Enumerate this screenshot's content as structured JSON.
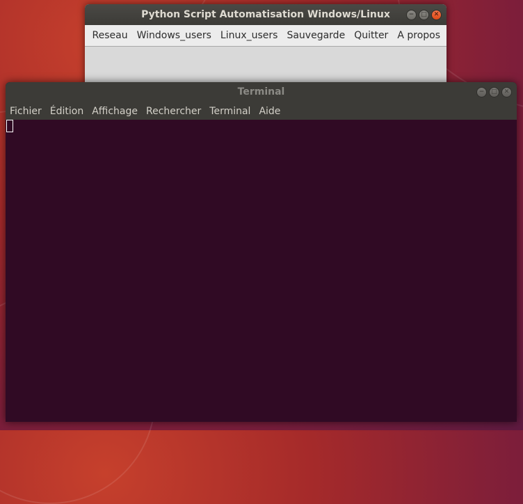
{
  "app_window": {
    "title": "Python Script Automatisation Windows/Linux",
    "menu": [
      "Reseau",
      "Windows_users",
      "Linux_users",
      "Sauvegarde",
      "Quitter",
      "A propos"
    ]
  },
  "terminal_window": {
    "title": "Terminal",
    "menu": [
      "Fichier",
      "Édition",
      "Affichage",
      "Rechercher",
      "Terminal",
      "Aide"
    ]
  },
  "window_controls": {
    "minimize": "minimize-icon",
    "maximize": "maximize-icon",
    "close": "close-icon"
  },
  "colors": {
    "terminal_background": "#300a24",
    "titlebar": "#3c3b37",
    "close_button": "#e95420"
  }
}
